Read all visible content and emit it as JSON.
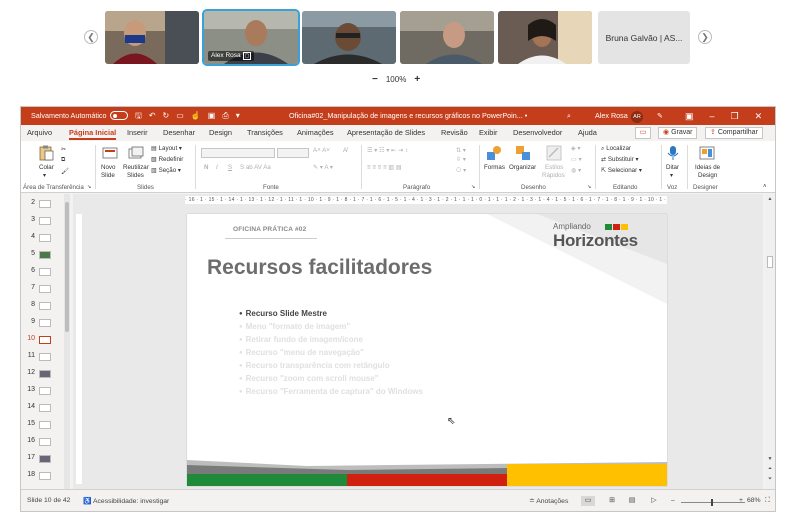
{
  "conference": {
    "participants": [
      {
        "name": ""
      },
      {
        "name": "Alex Rosa"
      },
      {
        "name": ""
      },
      {
        "name": ""
      },
      {
        "name": ""
      }
    ],
    "text_tile": "Bruna Galvão | AS...",
    "zoom_level": "100%",
    "zoom_minus": "−",
    "zoom_plus": "+"
  },
  "titlebar": {
    "autosave_label": "Salvamento Automático",
    "document_title": "Oficina#02_Manipulação de imagens e recursos gráficos no PowerPoin... •",
    "user_name": "Alex Rosa",
    "user_initials": "AR"
  },
  "menu": {
    "tabs": [
      "Arquivo",
      "Página Inicial",
      "Inserir",
      "Desenhar",
      "Design",
      "Transições",
      "Animações",
      "Apresentação de Slides",
      "Revisão",
      "Exibir",
      "Desenvolvedor",
      "Ajuda"
    ],
    "selected_tab": "Página Inicial",
    "save_label": "Gravar",
    "share_label": "Compartilhar"
  },
  "ribbon": {
    "clipboard": {
      "paste": "Colar",
      "group": "Área de Transferência"
    },
    "slides": {
      "new_slide": "Novo",
      "new_slide2": "Slide",
      "reuse": "Reutilizar",
      "reuse2": "Slides",
      "layout": "Layout",
      "reset": "Redefinir",
      "section": "Seção",
      "group": "Slides"
    },
    "font": {
      "group": "Fonte",
      "bold": "N",
      "italic": "I",
      "underline": "S"
    },
    "paragraph": {
      "group": "Parágrafo"
    },
    "drawing": {
      "shapes": "Formas",
      "arrange": "Organizar",
      "quick_styles": "Estilos",
      "quick_styles2": "Rápidos",
      "group": "Desenho"
    },
    "editing": {
      "find": "Localizar",
      "replace": "Substituir",
      "select": "Selecionar",
      "group": "Editando"
    },
    "voice": {
      "dictate": "Ditar",
      "group": "Voz"
    },
    "designer": {
      "ideas": "Ideias de",
      "ideas2": "Design",
      "group": "Designer"
    }
  },
  "ruler": {
    "ticks": "· 16 · 1 · 15 · 1 · 14 · 1 · 13 · 1 · 12 · 1 · 11 · 1 · 10 · 1 · 9 · 1 · 8 · 1 · 7 · 1 · 6 · 1 · 5 · 1 · 4 · 1 · 3 · 1 · 2 · 1 · 1 · 1 · 0 · 1 · 1 · 1 · 2 · 1 · 3 · 1 · 4 · 1 · 5 · 1 · 6 · 1 · 7 · 1 · 8 · 1 · 9 · 1 · 10 · 1 · 11 · 1 · 12 · 1 · 13 · 1 · 14 · 1 · 15 · 1 · 16 ·"
  },
  "thumbnails": {
    "numbers": [
      "2",
      "3",
      "4",
      "5",
      "6",
      "7",
      "8",
      "9",
      "10",
      "11",
      "12",
      "13",
      "14",
      "15",
      "16",
      "17",
      "18"
    ],
    "selected": "10"
  },
  "slide": {
    "kicker": "OFICINA PRÁTICA #02",
    "logo_small": "Ampliando",
    "logo_big": "Horizontes",
    "title": "Recursos facilitadores",
    "bullets": [
      "Recurso Slide Mestre",
      "Menu \"formato de imagem\"",
      "Retirar fundo de imagem/ícone",
      "Recurso \"menu de navegação\"",
      "Recurso transparência com retângulo",
      "Recurso \"zoom com scroll mouse\"",
      "Recurso \"Ferramenta de captura\" do Windows"
    ],
    "colors": {
      "green": "#1f8a3a",
      "red": "#d0200f",
      "yellow": "#ffc000"
    }
  },
  "statusbar": {
    "slide_count": "Slide 10 de 42",
    "accessibility": "Acessibilidade: investigar",
    "notes": "Anotações",
    "zoom": "68%"
  }
}
